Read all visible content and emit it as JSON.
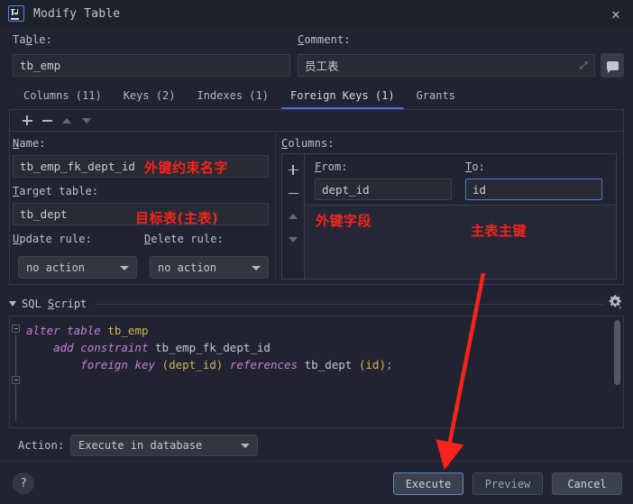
{
  "window": {
    "title": "Modify Table",
    "app_icon": "intellij-idea-icon",
    "close_icon": "✕"
  },
  "top_form": {
    "table_label": "Table:",
    "table_value": "tb_emp",
    "comment_label": "Comment:",
    "comment_value": "员工表",
    "expand_icon": "expand-icon",
    "comment_button_icon": "comment-bubble-icon"
  },
  "tabs": [
    {
      "label": "Columns (11)",
      "active": false
    },
    {
      "label": "Keys (2)",
      "active": false
    },
    {
      "label": "Indexes (1)",
      "active": false
    },
    {
      "label": "Foreign Keys (1)",
      "active": true
    },
    {
      "label": "Grants",
      "active": false
    }
  ],
  "toolbar": {
    "add_icon": "plus-icon",
    "remove_icon": "minus-icon",
    "move_up_icon": "arrow-up-icon",
    "move_down_icon": "arrow-down-icon"
  },
  "fk_form": {
    "name_label": "Name:",
    "name_value": "tb_emp_fk_dept_id",
    "target_table_label": "Target table:",
    "target_table_value": "tb_dept",
    "update_rule_label": "Update rule:",
    "update_rule_value": "no action",
    "delete_rule_label": "Delete rule:",
    "delete_rule_value": "no action"
  },
  "columns_panel": {
    "label": "Columns:",
    "from_header": "From:",
    "to_header": "To:",
    "rows": [
      {
        "from": "dept_id",
        "to": "id"
      }
    ]
  },
  "sql_section": {
    "title": "SQL Script",
    "collapse_icon": "triangle-down-icon",
    "settings_icon": "gear-icon",
    "code_lines": [
      [
        {
          "t": "alter",
          "c": "kw"
        },
        {
          "t": " ",
          "c": "plain"
        },
        {
          "t": "table",
          "c": "kw"
        },
        {
          "t": " ",
          "c": "plain"
        },
        {
          "t": "tb_emp",
          "c": "ident"
        }
      ],
      [
        {
          "t": "    ",
          "c": "plain"
        },
        {
          "t": "add",
          "c": "kw"
        },
        {
          "t": " ",
          "c": "plain"
        },
        {
          "t": "constraint",
          "c": "kw"
        },
        {
          "t": " ",
          "c": "plain"
        },
        {
          "t": "tb_emp_fk_dept_id",
          "c": "plain"
        }
      ],
      [
        {
          "t": "        ",
          "c": "plain"
        },
        {
          "t": "foreign",
          "c": "kw"
        },
        {
          "t": " ",
          "c": "plain"
        },
        {
          "t": "key",
          "c": "kw"
        },
        {
          "t": " ",
          "c": "plain"
        },
        {
          "t": "(",
          "c": "paren"
        },
        {
          "t": "dept_id",
          "c": "ident"
        },
        {
          "t": ")",
          "c": "paren"
        },
        {
          "t": " ",
          "c": "plain"
        },
        {
          "t": "references",
          "c": "kw"
        },
        {
          "t": " ",
          "c": "plain"
        },
        {
          "t": "tb_dept",
          "c": "plain"
        },
        {
          "t": " ",
          "c": "plain"
        },
        {
          "t": "(",
          "c": "paren"
        },
        {
          "t": "id",
          "c": "ident"
        },
        {
          "t": ")",
          "c": "paren"
        },
        {
          "t": ";",
          "c": "punct"
        }
      ]
    ]
  },
  "action_row": {
    "label": "Action:",
    "value": "Execute in database"
  },
  "bottom_bar": {
    "help_label": "?",
    "execute_label": "Execute",
    "preview_label": "Preview",
    "cancel_label": "Cancel"
  },
  "annotations": {
    "color": "#f8231c",
    "name_note": "外键约束名字",
    "target_note": "目标表(主表)",
    "from_note": "外键字段",
    "to_note": "主表主键",
    "arrow": "red-arrow-pointing-to-execute-button"
  },
  "colors": {
    "dialog_background": "#212430",
    "titlebar_background": "#1e2129",
    "field_background": "#282b36",
    "accent_blue": "#3a74e0",
    "focus_border": "#3d7ce8",
    "annotation_red": "#f8231c",
    "sql_keyword": "#c77dde",
    "sql_identifier": "#d4b25a"
  }
}
